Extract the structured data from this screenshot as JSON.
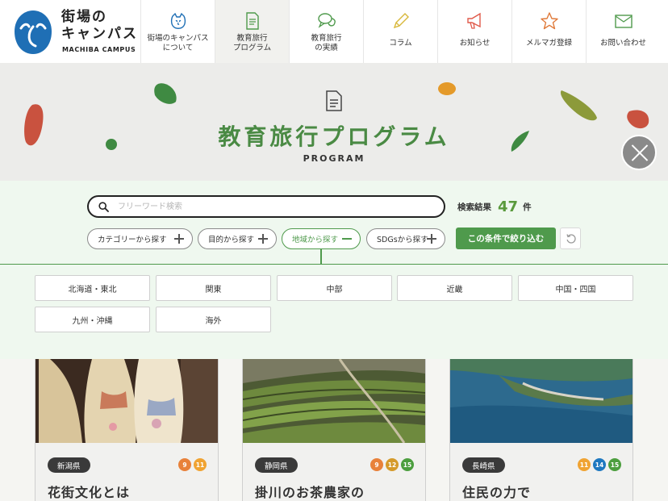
{
  "header": {
    "logo": {
      "title": "街場の\nキャンパス",
      "subtitle": "MACHIBA CAMPUS",
      "emblem_color": "#1f6fb5"
    },
    "nav": [
      {
        "label": "街場のキャンパス\nについて",
        "icon": "cat-face-icon"
      },
      {
        "label": "教育旅行\nプログラム",
        "icon": "document-icon",
        "active": true
      },
      {
        "label": "教育旅行\nの実績",
        "icon": "speech-bubbles-icon"
      },
      {
        "label": "コラム",
        "icon": "pencil-icon"
      },
      {
        "label": "お知らせ",
        "icon": "megaphone-icon"
      },
      {
        "label": "メルマガ登録",
        "icon": "star-icon"
      },
      {
        "label": "お問い合わせ",
        "icon": "envelope-icon"
      }
    ]
  },
  "hero": {
    "title": "教育旅行プログラム",
    "subtitle": "PROGRAM"
  },
  "search": {
    "placeholder": "フリーワード検索",
    "result_label": "検索結果",
    "result_count": "47",
    "result_unit": "件"
  },
  "filters": [
    {
      "label": "カテゴリーから探す",
      "active": false
    },
    {
      "label": "目的から探す",
      "active": false
    },
    {
      "label": "地域から探す",
      "active": true
    },
    {
      "label": "SDGsから探す",
      "active": false
    }
  ],
  "apply_label": "この条件で絞り込む",
  "regions": [
    "北海道・東北",
    "関東",
    "中部",
    "近畿",
    "中国・四国",
    "九州・沖縄",
    "海外"
  ],
  "cards": [
    {
      "prefecture": "新潟県",
      "title": "花街文化とは",
      "image": "kimono-photo",
      "badges": [
        {
          "n": "9",
          "color": "#e8813a"
        },
        {
          "n": "11",
          "color": "#f0a332"
        }
      ]
    },
    {
      "prefecture": "静岡県",
      "title": "掛川のお茶農家の",
      "image": "tea-field-photo",
      "badges": [
        {
          "n": "9",
          "color": "#e8813a"
        },
        {
          "n": "12",
          "color": "#d59a2a"
        },
        {
          "n": "15",
          "color": "#4c9e3e"
        }
      ]
    },
    {
      "prefecture": "長崎県",
      "title": "住民の力で",
      "image": "island-aerial-photo",
      "badges": [
        {
          "n": "11",
          "color": "#f0a332"
        },
        {
          "n": "14",
          "color": "#1e78c0"
        },
        {
          "n": "15",
          "color": "#4c9e3e"
        }
      ]
    }
  ],
  "colors": {
    "accent_green": "#4f9a4c",
    "panel_bg": "#eff8ef"
  }
}
